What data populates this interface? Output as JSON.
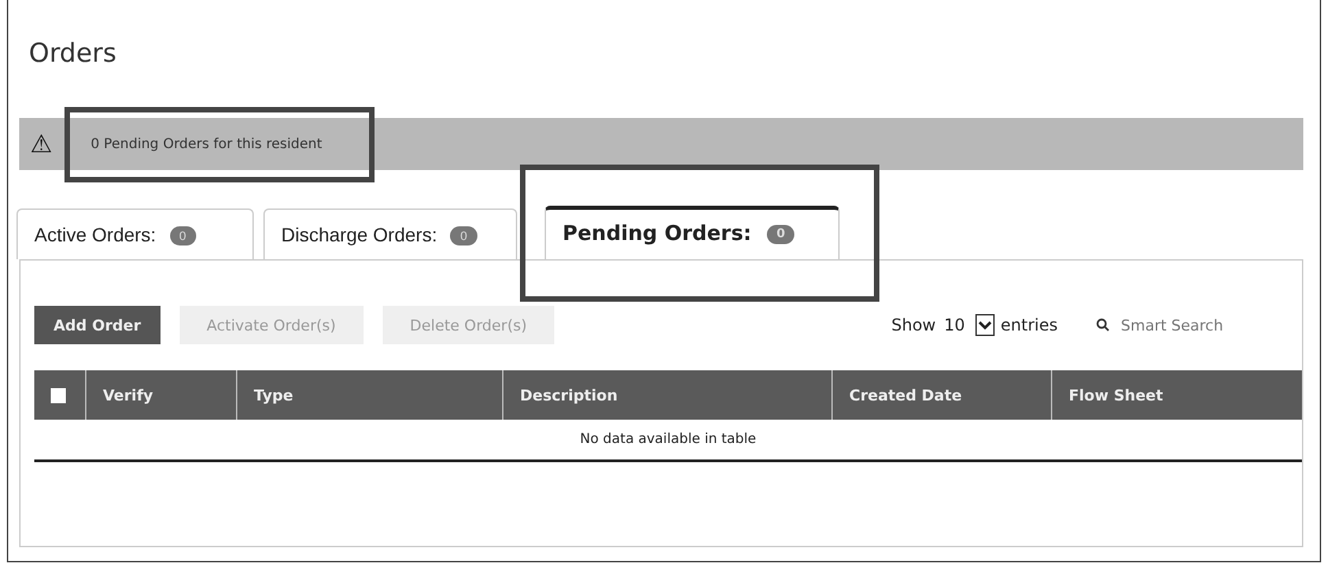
{
  "page_title": "Orders",
  "alert": {
    "icon": "⚠",
    "text": "0 Pending Orders for this resident"
  },
  "tabs": [
    {
      "label": "Active Orders:",
      "count": "0",
      "selected": false
    },
    {
      "label": "Discharge Orders:",
      "count": "0",
      "selected": false
    },
    {
      "label": "Pending Orders:",
      "count": "0",
      "selected": true
    }
  ],
  "toolbar": {
    "buttons": [
      {
        "label": "Add Order",
        "disabled": false
      },
      {
        "label": "Activate Order(s)",
        "disabled": true
      },
      {
        "label": "Delete Order(s)",
        "disabled": true
      }
    ],
    "show_label": "Show",
    "page_size": "10",
    "entries_label": "entries",
    "search_placeholder": "Smart Search"
  },
  "table": {
    "select_all_checked": false,
    "columns": [
      "Verify",
      "Type",
      "Description",
      "Created Date",
      "Flow Sheet"
    ],
    "empty_message": "No data available in table"
  }
}
